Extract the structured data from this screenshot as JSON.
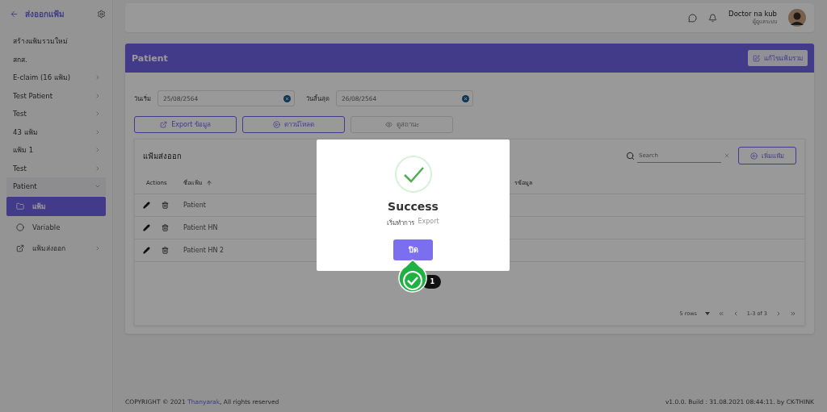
{
  "sidebar": {
    "title": "ส่งออกแฟ้ม",
    "items": [
      {
        "label": "สร้างแฟ้มรวมใหม่",
        "kind": "link"
      },
      {
        "label": "สกส.",
        "kind": "link"
      },
      {
        "label": "E-claim (16 แฟ้ม)",
        "kind": "group",
        "expanded": false
      },
      {
        "label": "Test Patient",
        "kind": "group",
        "expanded": false
      },
      {
        "label": "Test",
        "kind": "group",
        "expanded": false
      },
      {
        "label": "43 แฟ้ม",
        "kind": "group",
        "expanded": false
      },
      {
        "label": "แฟ้ม 1",
        "kind": "group",
        "expanded": false
      },
      {
        "label": "Test",
        "kind": "group",
        "expanded": false
      },
      {
        "label": "Patient",
        "kind": "group",
        "expanded": true,
        "children": [
          {
            "label": "แฟ้ม",
            "kind": "folder",
            "selected": true
          },
          {
            "label": "Variable",
            "kind": "variable",
            "selected": false
          },
          {
            "label": "แฟ้มส่งออก",
            "kind": "export",
            "selected": false
          }
        ]
      }
    ]
  },
  "header": {
    "user_name": "Doctor na kub",
    "user_role": "ผู้ดูแลระบบ"
  },
  "panel": {
    "title": "Patient",
    "edit_button": "แก้ไขแฟ้มรวม",
    "filters": [
      {
        "label": "วันเริ่ม",
        "value": "25/08/2564"
      },
      {
        "label": "วันสิ้นสุด",
        "value": "26/08/2564"
      }
    ],
    "actions": [
      {
        "label": "Export ข้อมูล",
        "kind": "export",
        "disabled": false
      },
      {
        "label": "ดาวน์โหลด",
        "kind": "download",
        "disabled": false
      },
      {
        "label": "ดูสถานะ",
        "kind": "status",
        "disabled": true
      }
    ]
  },
  "table": {
    "title": "แฟ้มส่งออก",
    "search_placeholder": "Search",
    "add_button": "เพิ่มแฟ้ม",
    "columns": [
      "Actions",
      "ชื่อแฟ้ม",
      "รข้อมูล"
    ],
    "rows": [
      {
        "name": "Patient"
      },
      {
        "name": "Patient HN"
      },
      {
        "name": "Patient HN 2"
      }
    ],
    "rows_per_page": "5 rows",
    "range": "1-3 of 3"
  },
  "footer": {
    "copyright": "COPYRIGHT © 2021",
    "company": "Thanyarak",
    "rights": ", All rights reserved",
    "version": "v1.0.0. Build : 31.08.2021 08:44:11. by CK-THINK"
  },
  "modal": {
    "title": "Success",
    "message_label": "เริ่มทำการ",
    "message_value": "Export",
    "button": "ปิด"
  },
  "tour_step": {
    "count": "1"
  }
}
